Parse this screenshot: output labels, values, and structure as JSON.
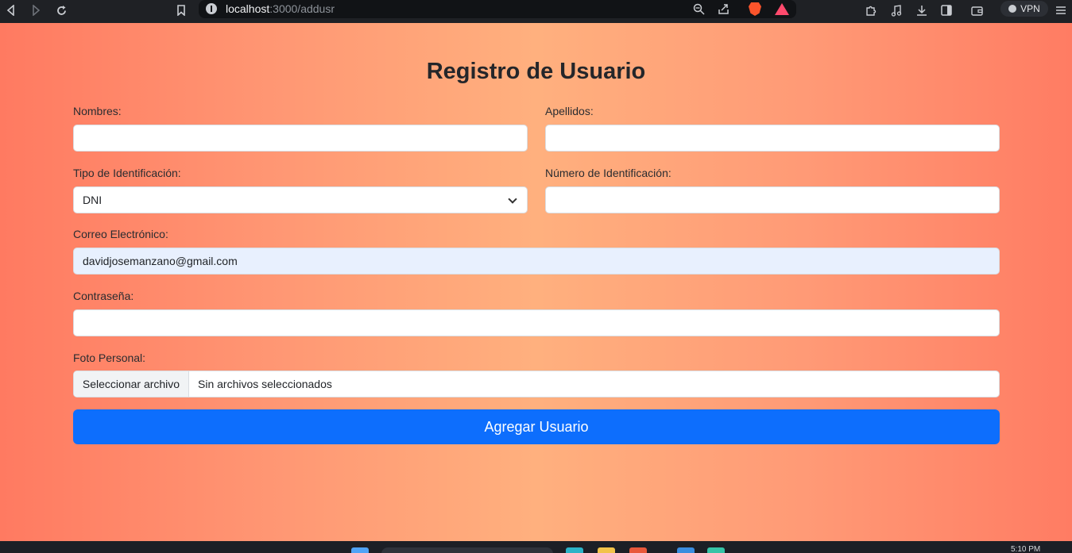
{
  "browser": {
    "url_host": "localhost",
    "url_path": ":3000/addusr",
    "vpn_label": "VPN"
  },
  "form": {
    "title": "Registro de Usuario",
    "nombres_label": "Nombres:",
    "nombres_value": "",
    "apellidos_label": "Apellidos:",
    "apellidos_value": "",
    "tipo_id_label": "Tipo de Identificación:",
    "tipo_id_value": "DNI",
    "numero_id_label": "Número de Identificación:",
    "numero_id_value": "",
    "correo_label": "Correo Electrónico:",
    "correo_value": "davidjosemanzano@gmail.com",
    "contrasena_label": "Contraseña:",
    "contrasena_value": "",
    "foto_label": "Foto Personal:",
    "foto_button": "Seleccionar archivo",
    "foto_status": "Sin archivos seleccionados",
    "submit_label": "Agregar Usuario"
  },
  "taskbar": {
    "clock": "5:10 PM"
  },
  "colors": {
    "accent": "#0d6efd",
    "autofill": "#e8f0fe",
    "gradient_edge": "#ff7a61",
    "gradient_center": "#ffb07e"
  },
  "icons": {
    "back": "back-arrow-icon",
    "forward": "forward-arrow-icon",
    "reload": "reload-icon",
    "bookmark": "bookmark-icon",
    "site_info": "site-info-icon",
    "zoom": "zoom-icon",
    "share": "share-icon",
    "brave": "brave-shield-icon",
    "rewards": "brave-rewards-icon",
    "extensions": "extensions-icon",
    "media": "media-icon",
    "downloads": "download-icon",
    "sidebar": "sidebar-icon",
    "wallet": "wallet-icon",
    "menu": "menu-icon",
    "select_chevron": "chevron-down-icon"
  }
}
